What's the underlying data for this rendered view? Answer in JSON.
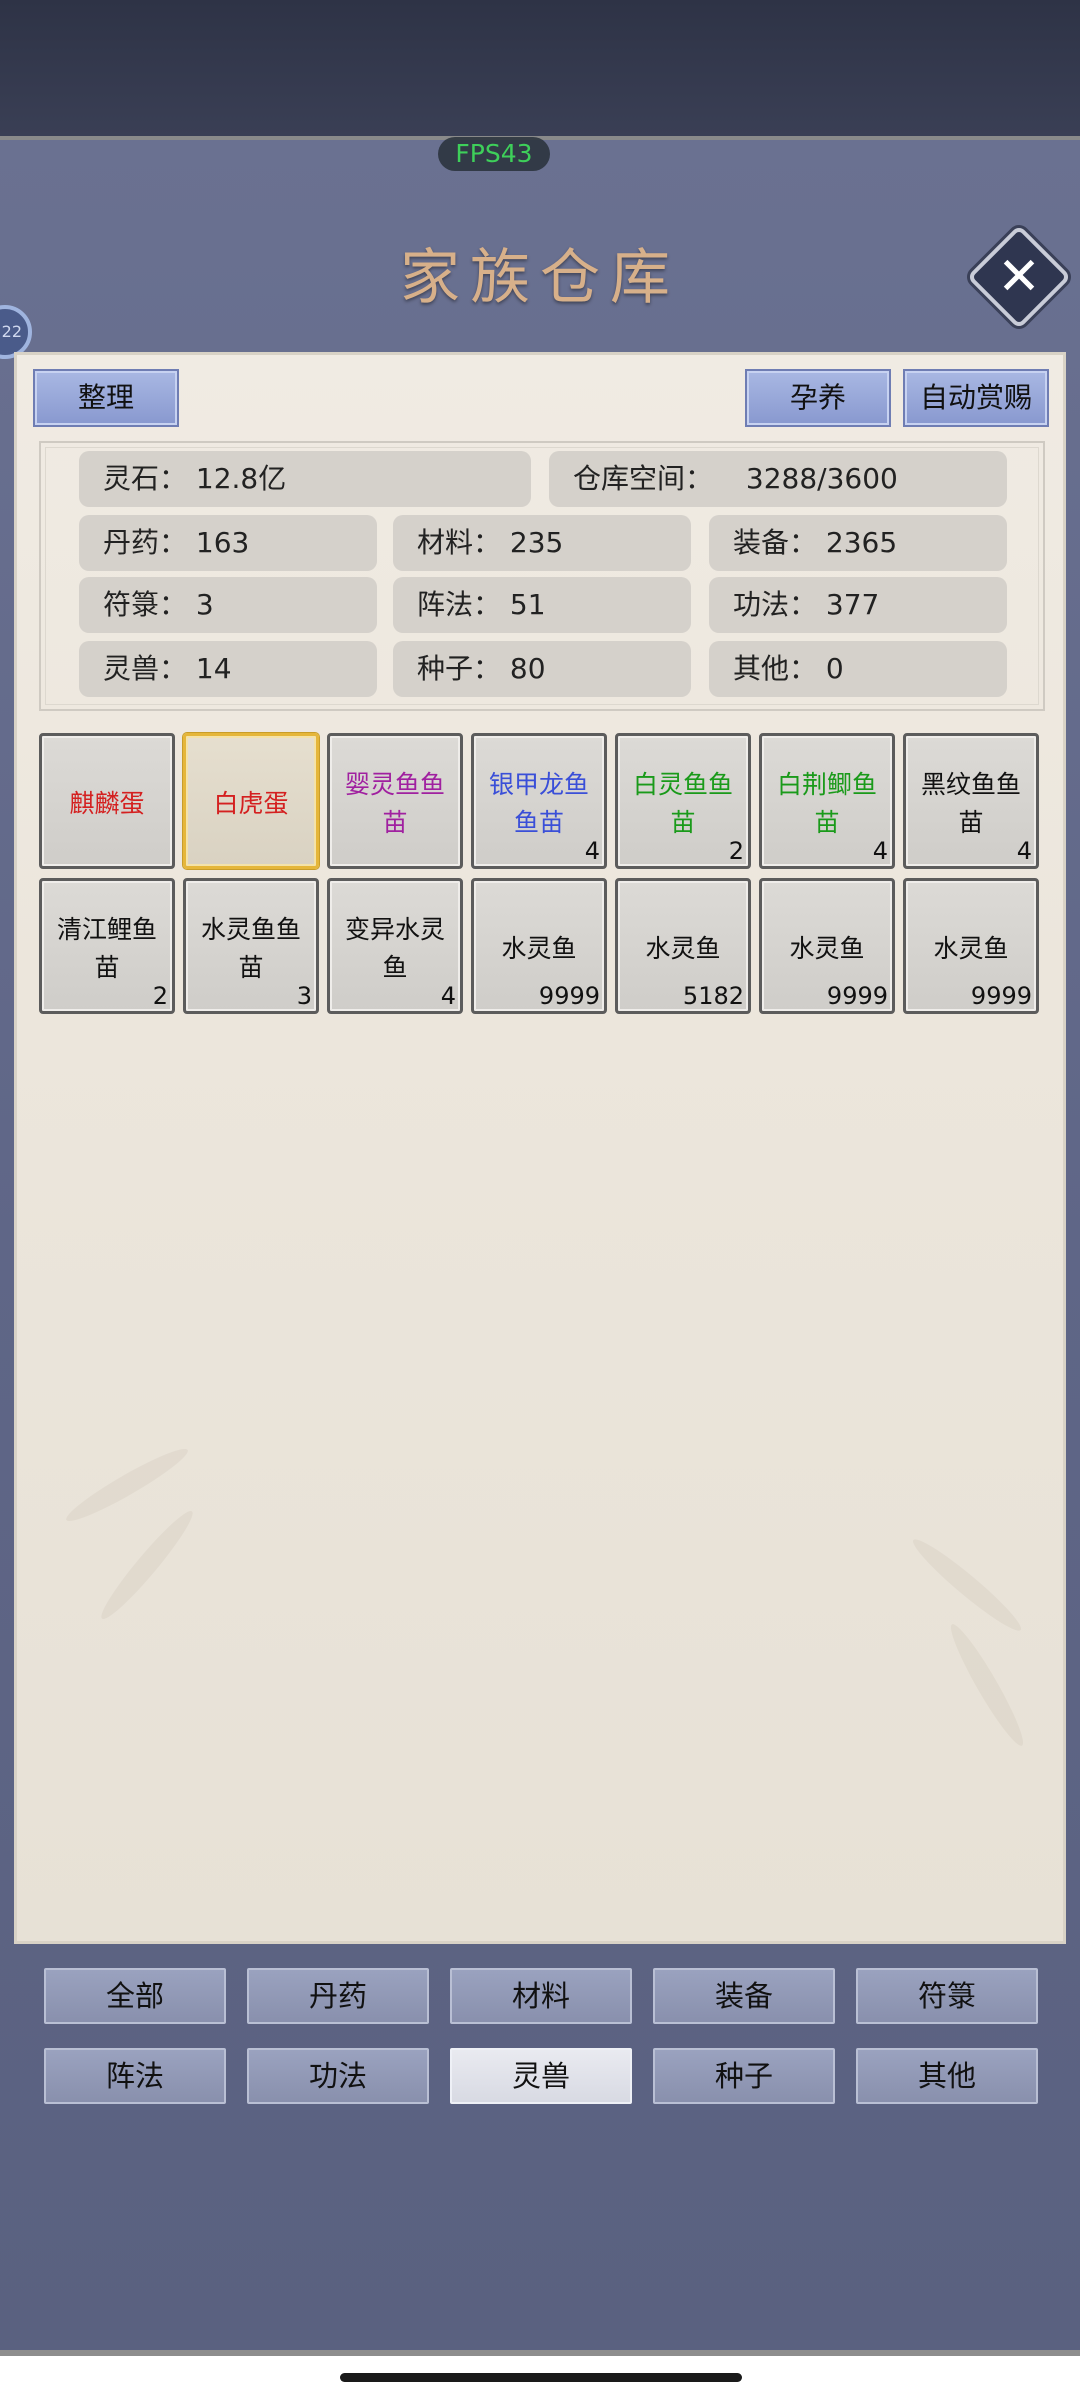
{
  "hud": {
    "fps": "FPS43",
    "side_badge": "22"
  },
  "title": "家族仓库",
  "toolbar": {
    "sort_label": "整理",
    "breed_label": "孕养",
    "auto_reward_label": "自动赏赐"
  },
  "colors": {
    "red": "#d42020",
    "purple": "#a020a0",
    "blue": "#3a4fd8",
    "green": "#1a9a1a",
    "black": "#111111",
    "accent_gold": "#e5b63a"
  },
  "stats": {
    "spirit_stone": "灵石：  12.8亿",
    "capacity_label": "仓库空间：",
    "capacity_value": "3288/3600",
    "pills": "丹药：  163",
    "materials": "材料：  235",
    "equipment": "装备：  2365",
    "talismans": "符箓：  3",
    "formations": "阵法：  51",
    "techniques": "功法：  377",
    "beasts": "灵兽：  14",
    "seeds": "种子：  80",
    "others": "其他：  0"
  },
  "items": [
    {
      "name": "麒麟蛋",
      "count": "",
      "color": "red",
      "selected": false,
      "icon": "item-slot"
    },
    {
      "name": "白虎蛋",
      "count": "",
      "color": "red",
      "selected": true,
      "icon": "item-slot"
    },
    {
      "name": "婴灵鱼鱼苗",
      "count": "",
      "color": "purple",
      "selected": false,
      "icon": "item-slot"
    },
    {
      "name": "银甲龙鱼鱼苗",
      "count": "4",
      "color": "blue",
      "selected": false,
      "icon": "item-slot"
    },
    {
      "name": "白灵鱼鱼苗",
      "count": "2",
      "color": "green",
      "selected": false,
      "icon": "item-slot"
    },
    {
      "name": "白荆鲫鱼苗",
      "count": "4",
      "color": "green",
      "selected": false,
      "icon": "item-slot"
    },
    {
      "name": "黑纹鱼鱼苗",
      "count": "4",
      "color": "black",
      "selected": false,
      "icon": "item-slot"
    },
    {
      "name": "清江鲤鱼苗",
      "count": "2",
      "color": "black",
      "selected": false,
      "icon": "item-slot"
    },
    {
      "name": "水灵鱼鱼苗",
      "count": "3",
      "color": "black",
      "selected": false,
      "icon": "item-slot"
    },
    {
      "name": "变异水灵鱼",
      "count": "4",
      "color": "black",
      "selected": false,
      "icon": "item-slot"
    },
    {
      "name": "水灵鱼",
      "count": "9999",
      "color": "black",
      "selected": false,
      "icon": "item-slot"
    },
    {
      "name": "水灵鱼",
      "count": "5182",
      "color": "black",
      "selected": false,
      "icon": "item-slot"
    },
    {
      "name": "水灵鱼",
      "count": "9999",
      "color": "black",
      "selected": false,
      "icon": "item-slot"
    },
    {
      "name": "水灵鱼",
      "count": "9999",
      "color": "black",
      "selected": false,
      "icon": "item-slot"
    }
  ],
  "tabs": [
    {
      "label": "全部",
      "active": false
    },
    {
      "label": "丹药",
      "active": false
    },
    {
      "label": "材料",
      "active": false
    },
    {
      "label": "装备",
      "active": false
    },
    {
      "label": "符箓",
      "active": false
    },
    {
      "label": "阵法",
      "active": false
    },
    {
      "label": "功法",
      "active": false
    },
    {
      "label": "灵兽",
      "active": true
    },
    {
      "label": "种子",
      "active": false
    },
    {
      "label": "其他",
      "active": false
    }
  ],
  "close_icon": "close-icon"
}
